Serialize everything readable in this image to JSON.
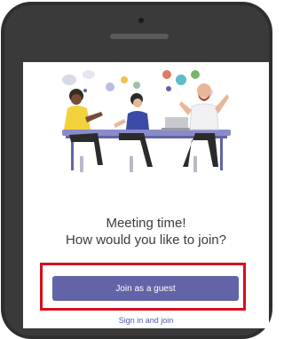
{
  "prompt": {
    "line1": "Meeting time!",
    "line2": "How would you like to join?"
  },
  "actions": {
    "join_guest_label": "Join as a guest",
    "sign_in_label": "Sign in and join"
  },
  "colors": {
    "accent": "#6264a7",
    "highlight": "#d4101c",
    "phone_frame": "#2f2f2f"
  }
}
